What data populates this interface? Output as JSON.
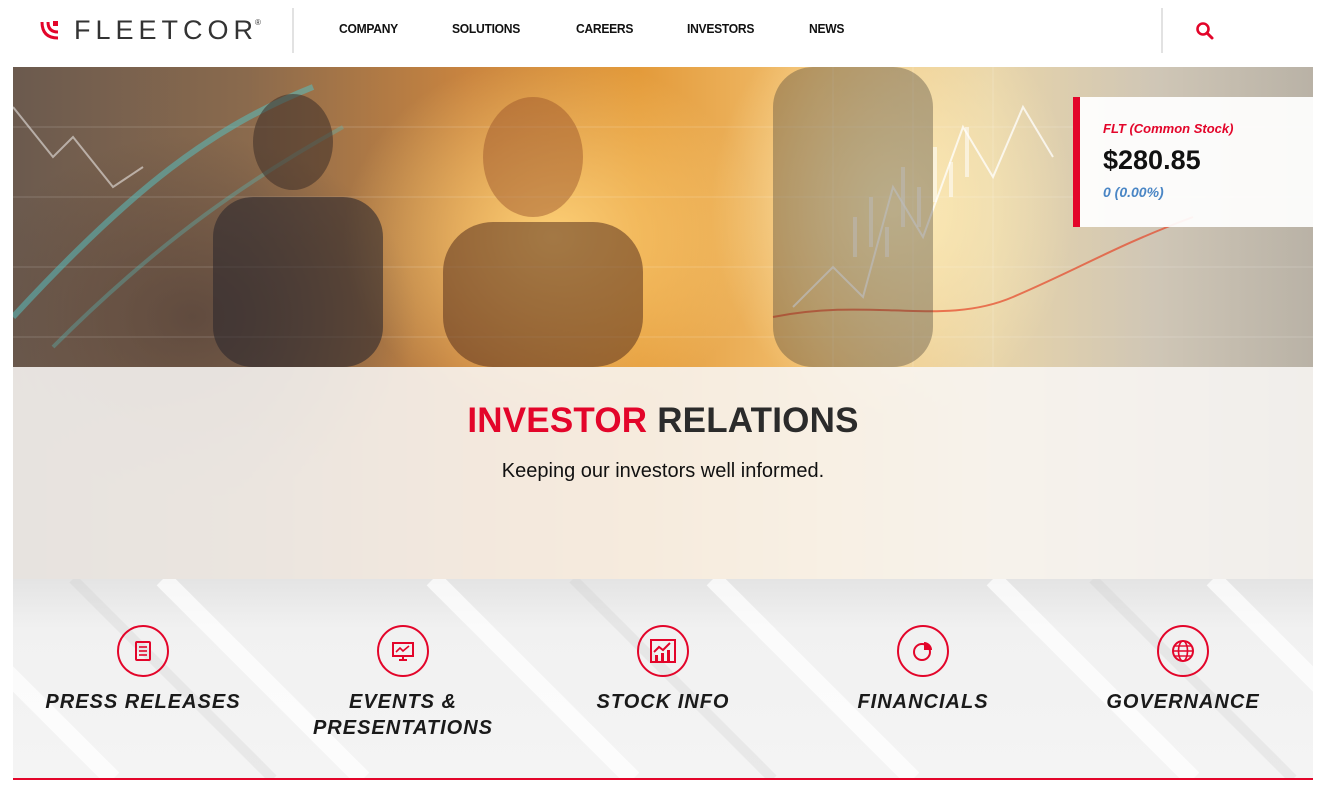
{
  "header": {
    "logo_text": "FLEETCOR",
    "logo_registered": "®",
    "nav": [
      {
        "label": "COMPANY"
      },
      {
        "label": "SOLUTIONS"
      },
      {
        "label": "CAREERS"
      },
      {
        "label": "INVESTORS"
      },
      {
        "label": "NEWS"
      }
    ],
    "search_icon": "search-icon"
  },
  "hero": {
    "title_highlight": "INVESTOR",
    "title_rest": "RELATIONS",
    "subtitle": "Keeping our investors well informed."
  },
  "ticker": {
    "name": "FLT (Common Stock)",
    "price": "$280.85",
    "change": "0 (0.00%)"
  },
  "links": [
    {
      "label": "PRESS RELEASES",
      "icon": "document-icon"
    },
    {
      "label": "EVENTS & PRESENTATIONS",
      "icon": "presentation-icon"
    },
    {
      "label": "STOCK INFO",
      "icon": "stock-chart-icon"
    },
    {
      "label": "FINANCIALS",
      "icon": "pie-chart-icon"
    },
    {
      "label": "GOVERNANCE",
      "icon": "globe-icon"
    }
  ],
  "colors": {
    "brand_red": "#e3052a",
    "change_blue": "#4a86c5",
    "text_dark": "#2b2b2b"
  }
}
